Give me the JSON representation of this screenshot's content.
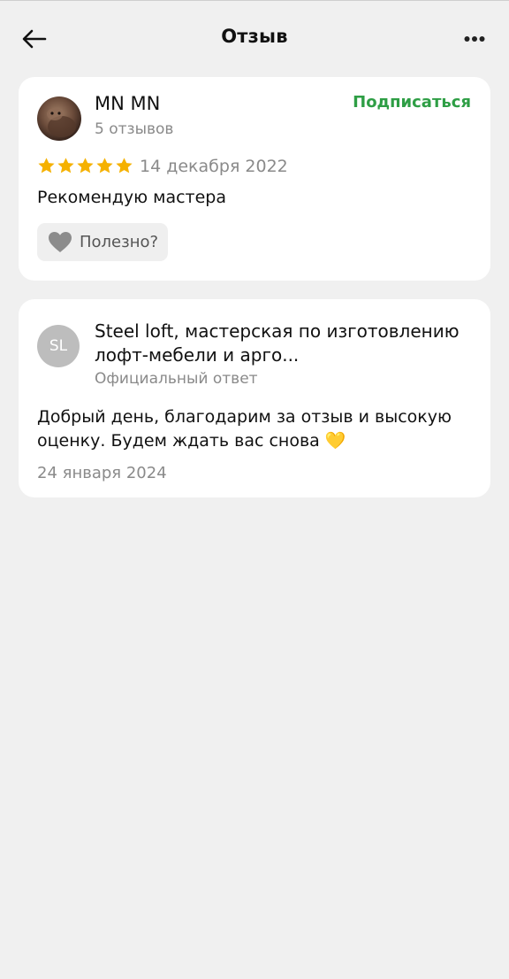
{
  "header": {
    "title": "Отзыв",
    "back_icon": "arrow-left-icon",
    "more_icon": "more-horizontal-icon"
  },
  "review": {
    "author_name": "MN MN",
    "author_reviews": "5 отзывов",
    "subscribe_label": "Подписаться",
    "rating": 5,
    "rating_max": 5,
    "date": "14 декабря 2022",
    "text": "Рекомендую мастера",
    "useful_label": "Полезно?"
  },
  "reply": {
    "avatar_initials": "SL",
    "author": "Steel loft, мастерская по изготовлению лофт-мебели и арго...",
    "role": "Официальный ответ",
    "text": "Добрый день, благодарим за отзыв и высокую оценку. Будем ждать вас снова 💛",
    "date": "24 января 2024"
  },
  "colors": {
    "accent_green": "#2e9e45",
    "star_yellow": "#f5b100",
    "background": "#f0f0f0"
  }
}
